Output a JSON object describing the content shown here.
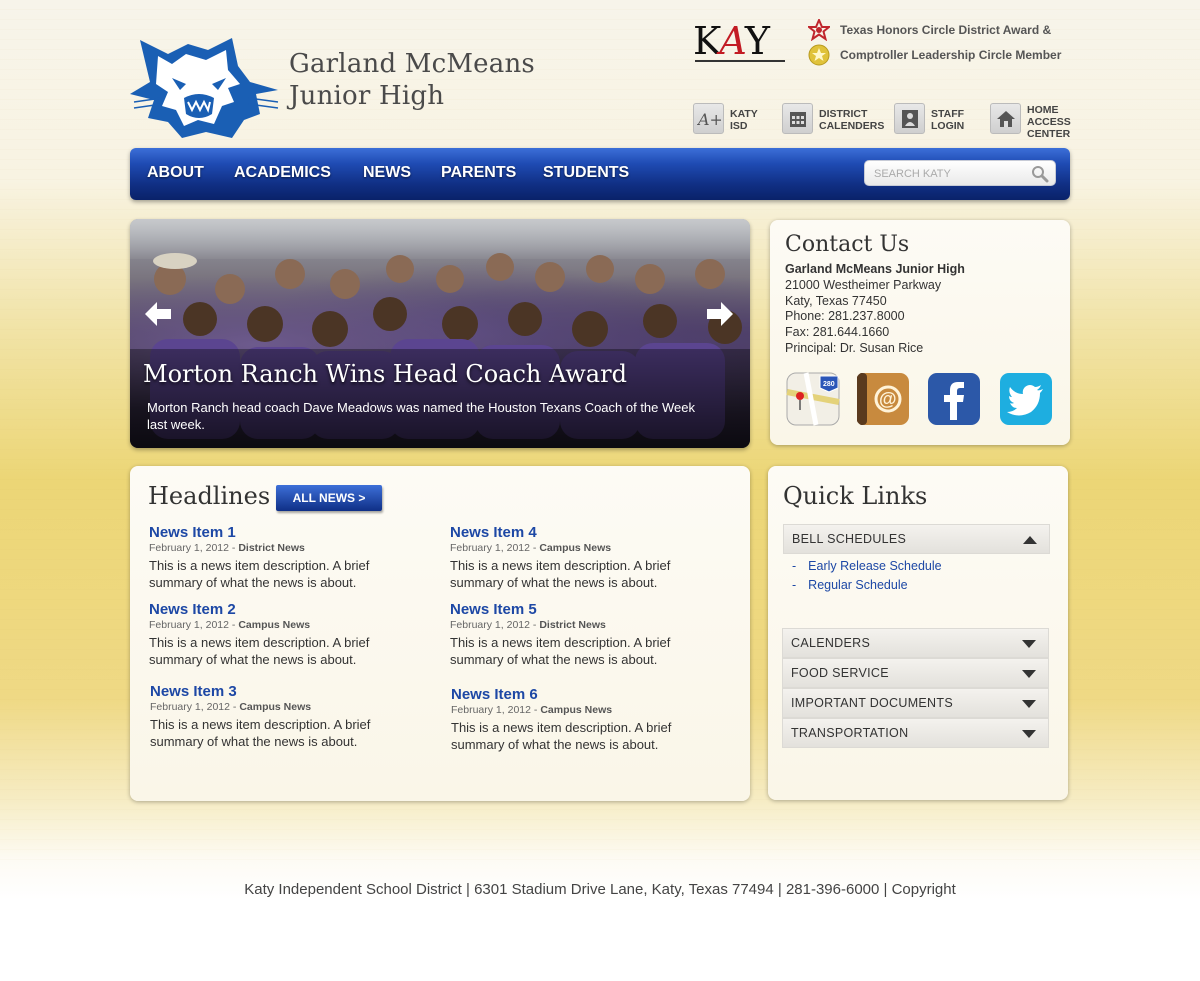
{
  "header": {
    "school_name_line1": "Garland McMeans",
    "school_name_line2": "Junior High",
    "district_logo": {
      "pre": "K",
      "a": "A",
      "post": "Y"
    },
    "awards": [
      "Texas Honors Circle District Award &",
      "Comptroller Leadership Circle Member"
    ],
    "utility_links": [
      {
        "line1": "KATY",
        "line2": "ISD",
        "line3": ""
      },
      {
        "line1": "DISTRICT",
        "line2": "CALENDERS",
        "line3": ""
      },
      {
        "line1": "STAFF",
        "line2": "LOGIN",
        "line3": ""
      },
      {
        "line1": "HOME",
        "line2": "ACCESS",
        "line3": "CENTER"
      }
    ]
  },
  "nav": {
    "items": [
      "ABOUT",
      "ACADEMICS",
      "NEWS",
      "PARENTS",
      "STUDENTS"
    ],
    "search_placeholder": "SEARCH KATY"
  },
  "slider": {
    "title": "Morton Ranch Wins Head Coach Award",
    "description": "Morton Ranch head coach Dave Meadows was named the Houston Texans Coach of the Week last week."
  },
  "contact": {
    "heading": "Contact Us",
    "name": "Garland McMeans Junior High",
    "address1": "21000 Westheimer Parkway",
    "address2": "Katy, Texas 77450",
    "phone": "Phone: 281.237.8000",
    "fax": "Fax: 281.644.1660",
    "principal": "Principal:  Dr. Susan Rice",
    "map_sign": "280"
  },
  "headlines": {
    "heading": "Headlines",
    "all_news_label": "ALL NEWS >",
    "items": [
      {
        "title": "News Item 1",
        "date": "February 1, 2012",
        "category": "District News",
        "desc": "This is a news item description. A brief summary of what the news is about."
      },
      {
        "title": "News Item 2",
        "date": "February 1, 2012",
        "category": "Campus News",
        "desc": "This is a news item description. A brief summary of what the news is about."
      },
      {
        "title": "News Item 3",
        "date": "February 1, 2012",
        "category": "Campus News",
        "desc": "This is a news item description. A brief summary of what the news is about."
      },
      {
        "title": "News Item 4",
        "date": "February 1, 2012",
        "category": "Campus News",
        "desc": "This is a news item description. A brief summary of what the news is about."
      },
      {
        "title": "News Item 5",
        "date": "February 1, 2012",
        "category": "District News",
        "desc": "This is a news item description. A brief summary of what the news is about."
      },
      {
        "title": "News Item 6",
        "date": "February 1, 2012",
        "category": "Campus News",
        "desc": "This is a news item description. A brief summary of what the news is about."
      }
    ]
  },
  "quick_links": {
    "heading": "Quick Links",
    "sections": [
      {
        "label": "BELL SCHEDULES",
        "expanded": true,
        "links": [
          "Early Release Schedule",
          "Regular Schedule"
        ]
      },
      {
        "label": "CALENDERS",
        "expanded": false
      },
      {
        "label": "FOOD SERVICE",
        "expanded": false
      },
      {
        "label": "IMPORTANT DOCUMENTS",
        "expanded": false
      },
      {
        "label": "TRANSPORTATION",
        "expanded": false
      }
    ]
  },
  "footer": {
    "text": "Katy Independent School District | 6301 Stadium Drive Lane, Katy, Texas 77494 | 281-396-6000 | Copyright"
  },
  "colors": {
    "nav_blue": "#102f84",
    "link_blue": "#1d48a5",
    "background_gold": "#ecd676"
  },
  "icons": [
    "wildcat-logo",
    "katy-logo",
    "honors-star-icon",
    "comptroller-seal-icon",
    "katy-isd-icon",
    "calendar-icon",
    "staff-icon",
    "home-icon",
    "search-icon",
    "arrow-left-icon",
    "arrow-right-icon",
    "maps-icon",
    "address-book-icon",
    "facebook-icon",
    "twitter-icon",
    "triangle-up-icon",
    "triangle-down-icon"
  ]
}
